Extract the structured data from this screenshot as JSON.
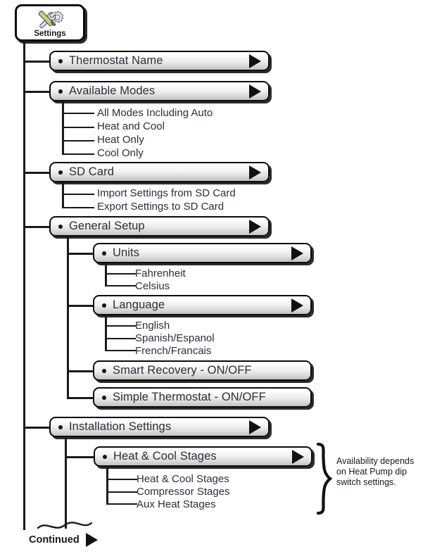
{
  "diagram": {
    "title": "Settings",
    "root": {
      "label": "Settings",
      "icon": "tools-icon"
    },
    "arrow_glyph": "▶",
    "nodes": [
      {
        "label": "Thermostat Name",
        "arrow": true
      },
      {
        "label": "Available Modes",
        "arrow": true
      },
      {
        "label": "SD Card",
        "arrow": true
      },
      {
        "label": "General Setup",
        "arrow": true
      },
      {
        "label": "Units",
        "arrow": true
      },
      {
        "label": "Language",
        "arrow": true
      },
      {
        "label": "Smart Recovery - ON/OFF",
        "arrow": false
      },
      {
        "label": "Simple Thermostat - ON/OFF",
        "arrow": false
      },
      {
        "label": "Installation Settings",
        "arrow": true
      },
      {
        "label": "Heat & Cool Stages",
        "arrow": true
      }
    ],
    "leaves": [
      "All Modes Including Auto",
      "Heat and Cool",
      "Heat Only",
      "Cool Only",
      "Import Settings from SD Card",
      "Export Settings to SD Card",
      "Fahrenheit",
      "Celsius",
      "English",
      "Spanish/Espanol",
      "French/Francais",
      "Heat & Cool Stages",
      "Compressor Stages",
      "Aux Heat Stages"
    ],
    "annotation": {
      "line1": "Availability depends",
      "line2": "on Heat Pump dip",
      "line3": "switch settings."
    },
    "footer": {
      "label": "Continued",
      "arrow_glyph": "▶"
    },
    "colors": {
      "line": "#1a1a1a",
      "box_border": "#0b0b0b",
      "box_shadow": "#2b2b2b",
      "text": "#2a2f3a",
      "note_text": "#14181f"
    }
  }
}
